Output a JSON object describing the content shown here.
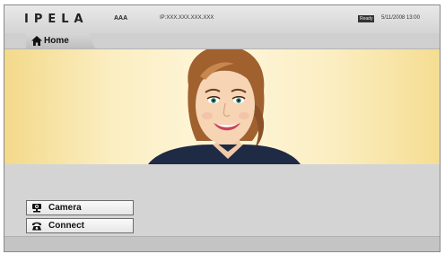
{
  "header": {
    "logo": "IPELA",
    "user_name": "AAA",
    "ip_address": "IP:XXX.XXX.XXX.XXX",
    "status": "Ready",
    "datetime": "5/11/2008 13:00"
  },
  "tab": {
    "label": "Home",
    "icon": "home-icon"
  },
  "video": {
    "content": "video-feed-avatar"
  },
  "menu": {
    "items": [
      {
        "label": "Camera",
        "icon": "camera-icon"
      },
      {
        "label": "Connect",
        "icon": "phone-icon"
      }
    ]
  },
  "colors": {
    "background_gray": "#cfcfcf",
    "video_yellow": "#f3d98a",
    "button_border": "#6d6d6d"
  }
}
